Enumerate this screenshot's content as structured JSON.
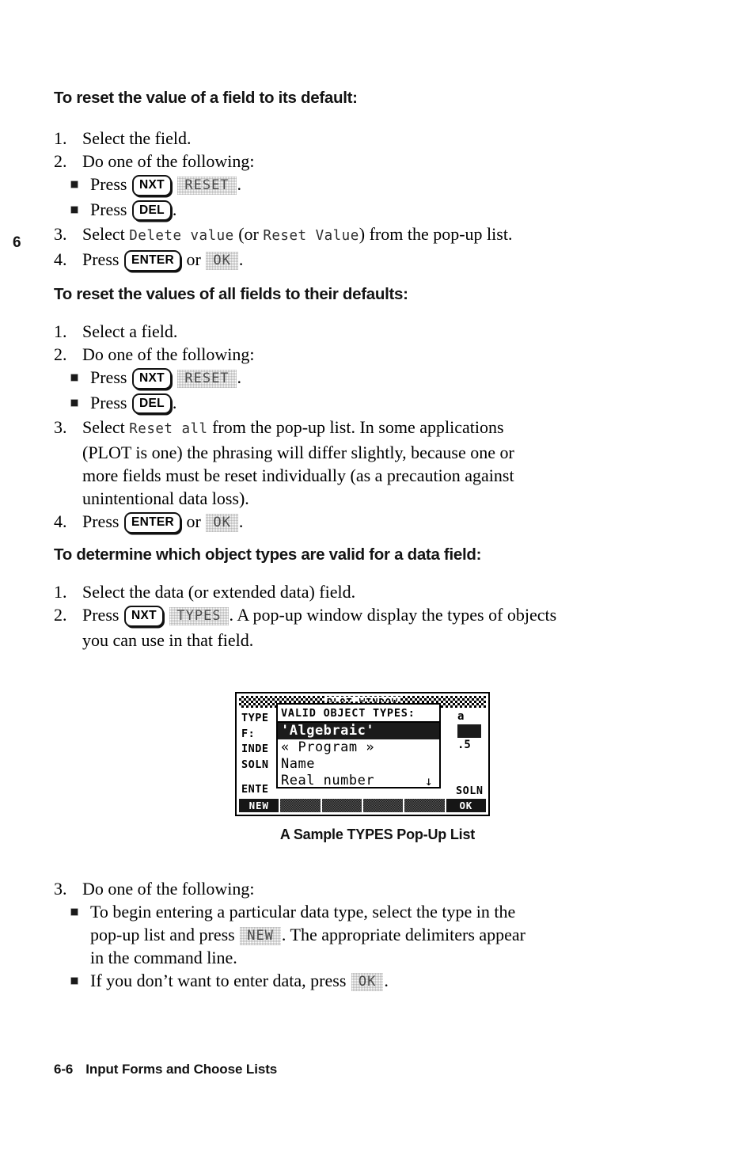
{
  "chapter_marker": "6",
  "sections": [
    {
      "heading": "To reset the value of a field to its default:",
      "steps": [
        {
          "num": "1.",
          "text": "Select the field."
        },
        {
          "num": "2.",
          "text": "Do one of the following:"
        }
      ],
      "bullets": [
        {
          "pre": "Press",
          "keycap": "NXT",
          "softkey": "RESET",
          "post": "."
        },
        {
          "pre": "Press",
          "keycap": "DEL",
          "softkey": "",
          "post": "."
        }
      ],
      "steps_after": [
        {
          "num": "3.",
          "pre": "Select ",
          "term1": "Delete value",
          "mid": " (or ",
          "term2": "Reset Value",
          "post": ") from the pop-up list."
        },
        {
          "num": "4.",
          "pre": "Press ",
          "keycap": "ENTER",
          "mid": " or ",
          "softkey": "OK",
          "post": "."
        }
      ]
    },
    {
      "heading": "To reset the values of all fields to their defaults:",
      "steps": [
        {
          "num": "1.",
          "text": "Select a field."
        },
        {
          "num": "2.",
          "text": "Do one of the following:"
        }
      ],
      "bullets": [
        {
          "pre": "Press",
          "keycap": "NXT",
          "softkey": "RESET",
          "post": "."
        },
        {
          "pre": "Press",
          "keycap": "DEL",
          "softkey": "",
          "post": "."
        }
      ],
      "steps_after": [
        {
          "num": "3.",
          "pre": "Select ",
          "term1": "Reset all",
          "post": " from the pop-up list. In some applications",
          "line2": "(PLOT is one) the phrasing will differ slightly, because one or",
          "line3": "more fields must be reset individually (as a precaution against",
          "line4": "unintentional data loss)."
        },
        {
          "num": "4.",
          "pre": "Press ",
          "keycap": "ENTER",
          "mid": " or ",
          "softkey": "OK",
          "post": "."
        }
      ]
    },
    {
      "heading": "To determine which object types are valid for a data field:",
      "steps_plain": [
        {
          "num": "1.",
          "text": "Select the data (or extended data) field."
        }
      ],
      "step2": {
        "num": "2.",
        "pre": "Press ",
        "keycap": "NXT",
        "softkey": "TYPES",
        "post": ". A pop-up window display the types of objects",
        "line2": "you can use in that field."
      }
    }
  ],
  "figure": {
    "lcd": {
      "title_bar_text": "PLOT WINDOW",
      "field_labels": [
        "TYPE",
        "F:",
        "INDE",
        "SOLN"
      ],
      "enter_label": "ENTE",
      "right_fragments": [
        "a",
        ".5"
      ],
      "right_soln_label": "SOLN",
      "popup": {
        "title": "VALID OBJECT TYPES:",
        "items": [
          {
            "label": "'Algebraic'",
            "selected": true
          },
          {
            "label": "« Program »",
            "selected": false
          },
          {
            "label": "Name",
            "selected": false
          },
          {
            "label": "Real number",
            "selected": false,
            "arrow": "↓"
          }
        ]
      },
      "menu_keys": [
        "NEW",
        "",
        "",
        "",
        "",
        "OK"
      ]
    },
    "caption": "A Sample TYPES Pop-Up List"
  },
  "final_section": {
    "step3": {
      "num": "3.",
      "text": "Do one of the following:"
    },
    "bullets": [
      {
        "pre": "To begin entering a particular data type, select the type in the",
        "line2_pre": "pop-up list and press ",
        "softkey": "NEW",
        "line2_post": ". The appropriate delimiters appear",
        "line3": "in the command line."
      },
      {
        "pre": "If you don’t want to enter data, press ",
        "softkey": "OK",
        "post": "."
      }
    ]
  },
  "footer": {
    "page_number": "6-6",
    "title": "Input Forms and Choose Lists"
  }
}
